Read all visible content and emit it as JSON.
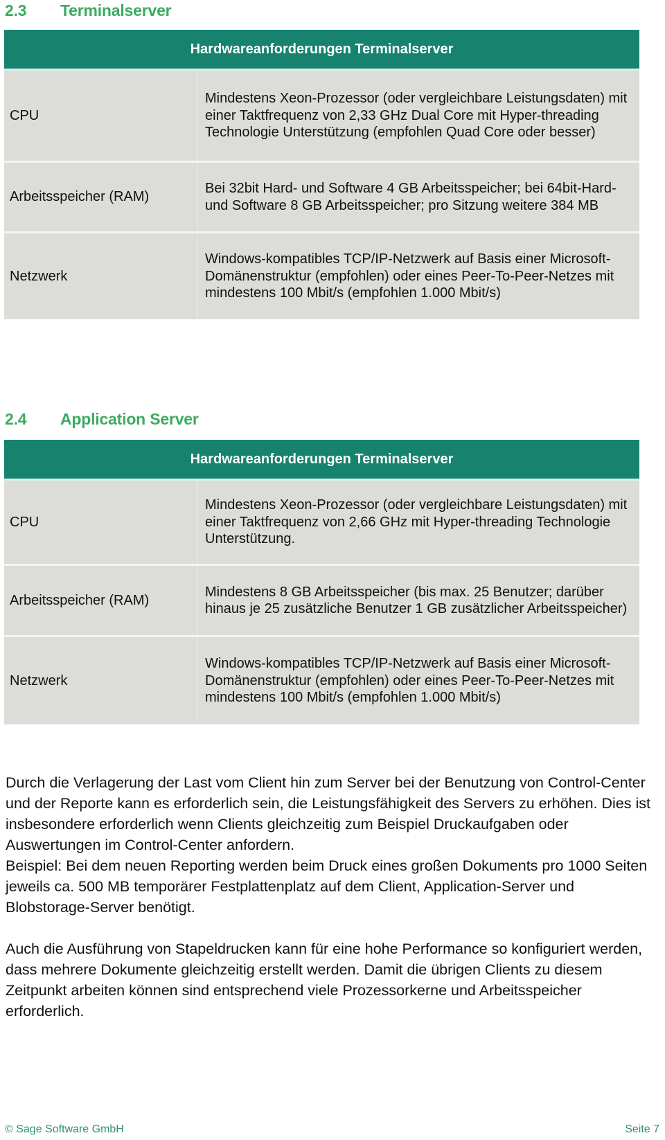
{
  "sections": [
    {
      "number": "2.3",
      "title": "Terminalserver",
      "table": {
        "header": "Hardwareanforderungen Terminalserver",
        "rows": [
          {
            "label": "CPU",
            "value": "Mindestens Xeon-Prozessor (oder vergleichbare Leistungsdaten) mit einer Taktfrequenz von 2,33 GHz Dual Core mit Hyper-threading Technologie Unterstützung (empfohlen Quad Core oder besser)"
          },
          {
            "label": "Arbeitsspeicher (RAM)",
            "value": "Bei 32bit Hard- und Software 4 GB Arbeitsspeicher; bei 64bit-Hard- und Software 8 GB Arbeitsspeicher; pro Sitzung weitere 384 MB"
          },
          {
            "label": "Netzwerk",
            "value": "Windows-kompatibles TCP/IP-Netzwerk auf Basis einer Microsoft-Domänenstruktur (empfohlen) oder eines Peer-To-Peer-Netzes mit mindestens 100 Mbit/s (empfohlen 1.000 Mbit/s)"
          }
        ]
      }
    },
    {
      "number": "2.4",
      "title": "Application Server",
      "table": {
        "header": "Hardwareanforderungen Terminalserver",
        "rows": [
          {
            "label": "CPU",
            "value": "Mindestens Xeon-Prozessor (oder vergleichbare Leistungsdaten) mit einer Taktfrequenz von 2,66 GHz mit Hyper-threading Technologie Unterstützung."
          },
          {
            "label": "Arbeitsspeicher (RAM)",
            "value": "Mindestens 8 GB Arbeitsspeicher (bis max. 25 Benutzer; darüber hinaus je 25 zusätzliche Benutzer 1 GB zusätzlicher Arbeitsspeicher)"
          },
          {
            "label": "Netzwerk",
            "value": "Windows-kompatibles TCP/IP-Netzwerk auf Basis einer Microsoft-Domänenstruktur (empfohlen) oder eines Peer-To-Peer-Netzes mit mindestens 100 Mbit/s (empfohlen 1.000 Mbit/s)"
          }
        ]
      }
    }
  ],
  "paragraphs": [
    "Durch die Verlagerung der Last vom Client hin zum Server bei der Benutzung von Control-Center und der Reporte kann es erforderlich sein, die Leistungsfähigkeit des Servers zu erhöhen. Dies ist insbesondere erforderlich wenn Clients gleichzeitig zum Beispiel Druckaufgaben oder Auswertungen im Control-Center anfordern.",
    "Beispiel: Bei dem neuen Reporting werden beim Druck eines großen Dokuments pro 1000 Seiten jeweils ca. 500 MB temporärer Festplattenplatz auf dem Client, Application-Server und Blobstorage-Server benötigt.",
    "Auch die Ausführung von Stapeldrucken kann für eine hohe Performance so konfiguriert werden, dass mehrere Dokumente gleichzeitig erstellt werden. Damit die übrigen Clients zu diesem Zeitpunkt arbeiten können sind entsprechend viele Prozessorkerne und Arbeitsspeicher erforderlich."
  ],
  "footer": {
    "copyright": "© Sage Software GmbH",
    "page": "Seite 7"
  },
  "colors": {
    "heading_green": "#3cab5e",
    "table_header": "#17836f",
    "table_row": "#dcdcd8",
    "footer_text": "#2f8f78"
  }
}
